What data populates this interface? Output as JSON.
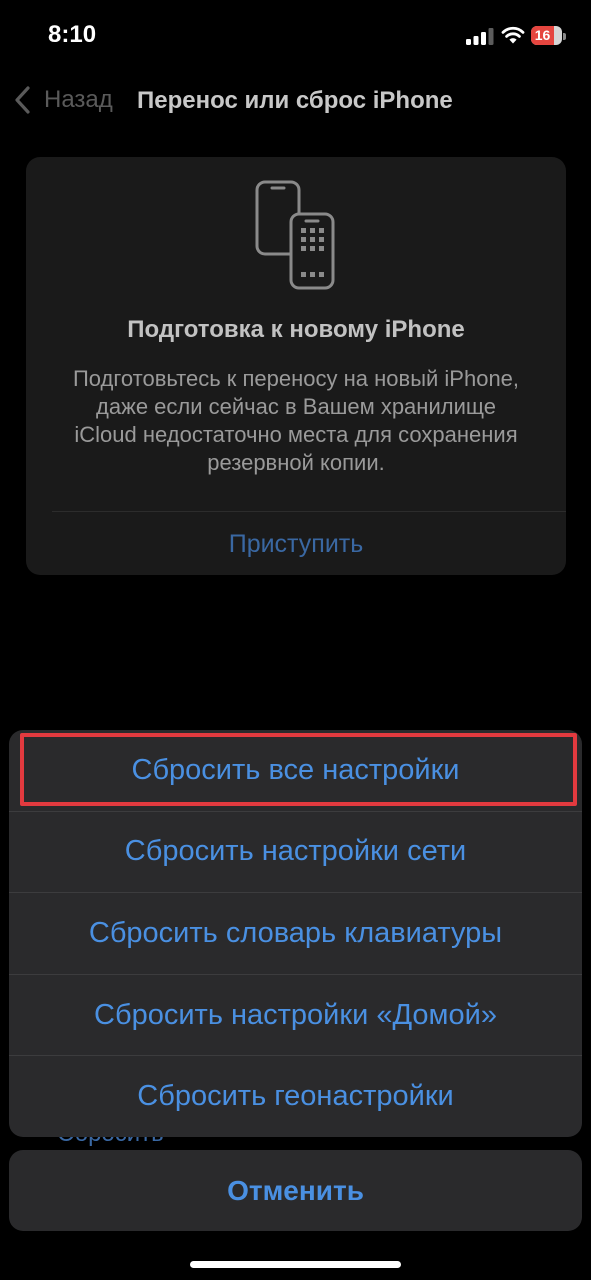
{
  "status_bar": {
    "time": "8:10",
    "battery_percent": "16",
    "signal_icon": "cellular-signal-icon",
    "wifi_icon": "wifi-icon",
    "battery_icon": "battery-icon"
  },
  "nav": {
    "back_icon": "chevron-left-icon",
    "back_label": "Назад",
    "title": "Перенос или сброс iPhone"
  },
  "card": {
    "icon": "two-phones-icon",
    "title": "Подготовка к новому iPhone",
    "description_lines": [
      "Подготовьтесь к переносу на новый iPhone,",
      "даже если сейчас в Вашем хранилище",
      "iCloud недостаточно места для сохранения",
      "резервной копии."
    ],
    "action_label": "Приступить"
  },
  "background": {
    "partial_link": "Сбросить"
  },
  "action_sheet": {
    "items": [
      {
        "label": "Сбросить все настройки",
        "highlighted": true
      },
      {
        "label": "Сбросить настройки сети"
      },
      {
        "label": "Сбросить словарь клавиатуры"
      },
      {
        "label": "Сбросить настройки «Домой»"
      },
      {
        "label": "Сбросить геонастройки"
      }
    ],
    "cancel_label": "Отменить"
  },
  "colors": {
    "accent": "#4a90e2",
    "highlight": "#e23a3f",
    "battery_low": "#e5453f",
    "background": "#000000"
  }
}
